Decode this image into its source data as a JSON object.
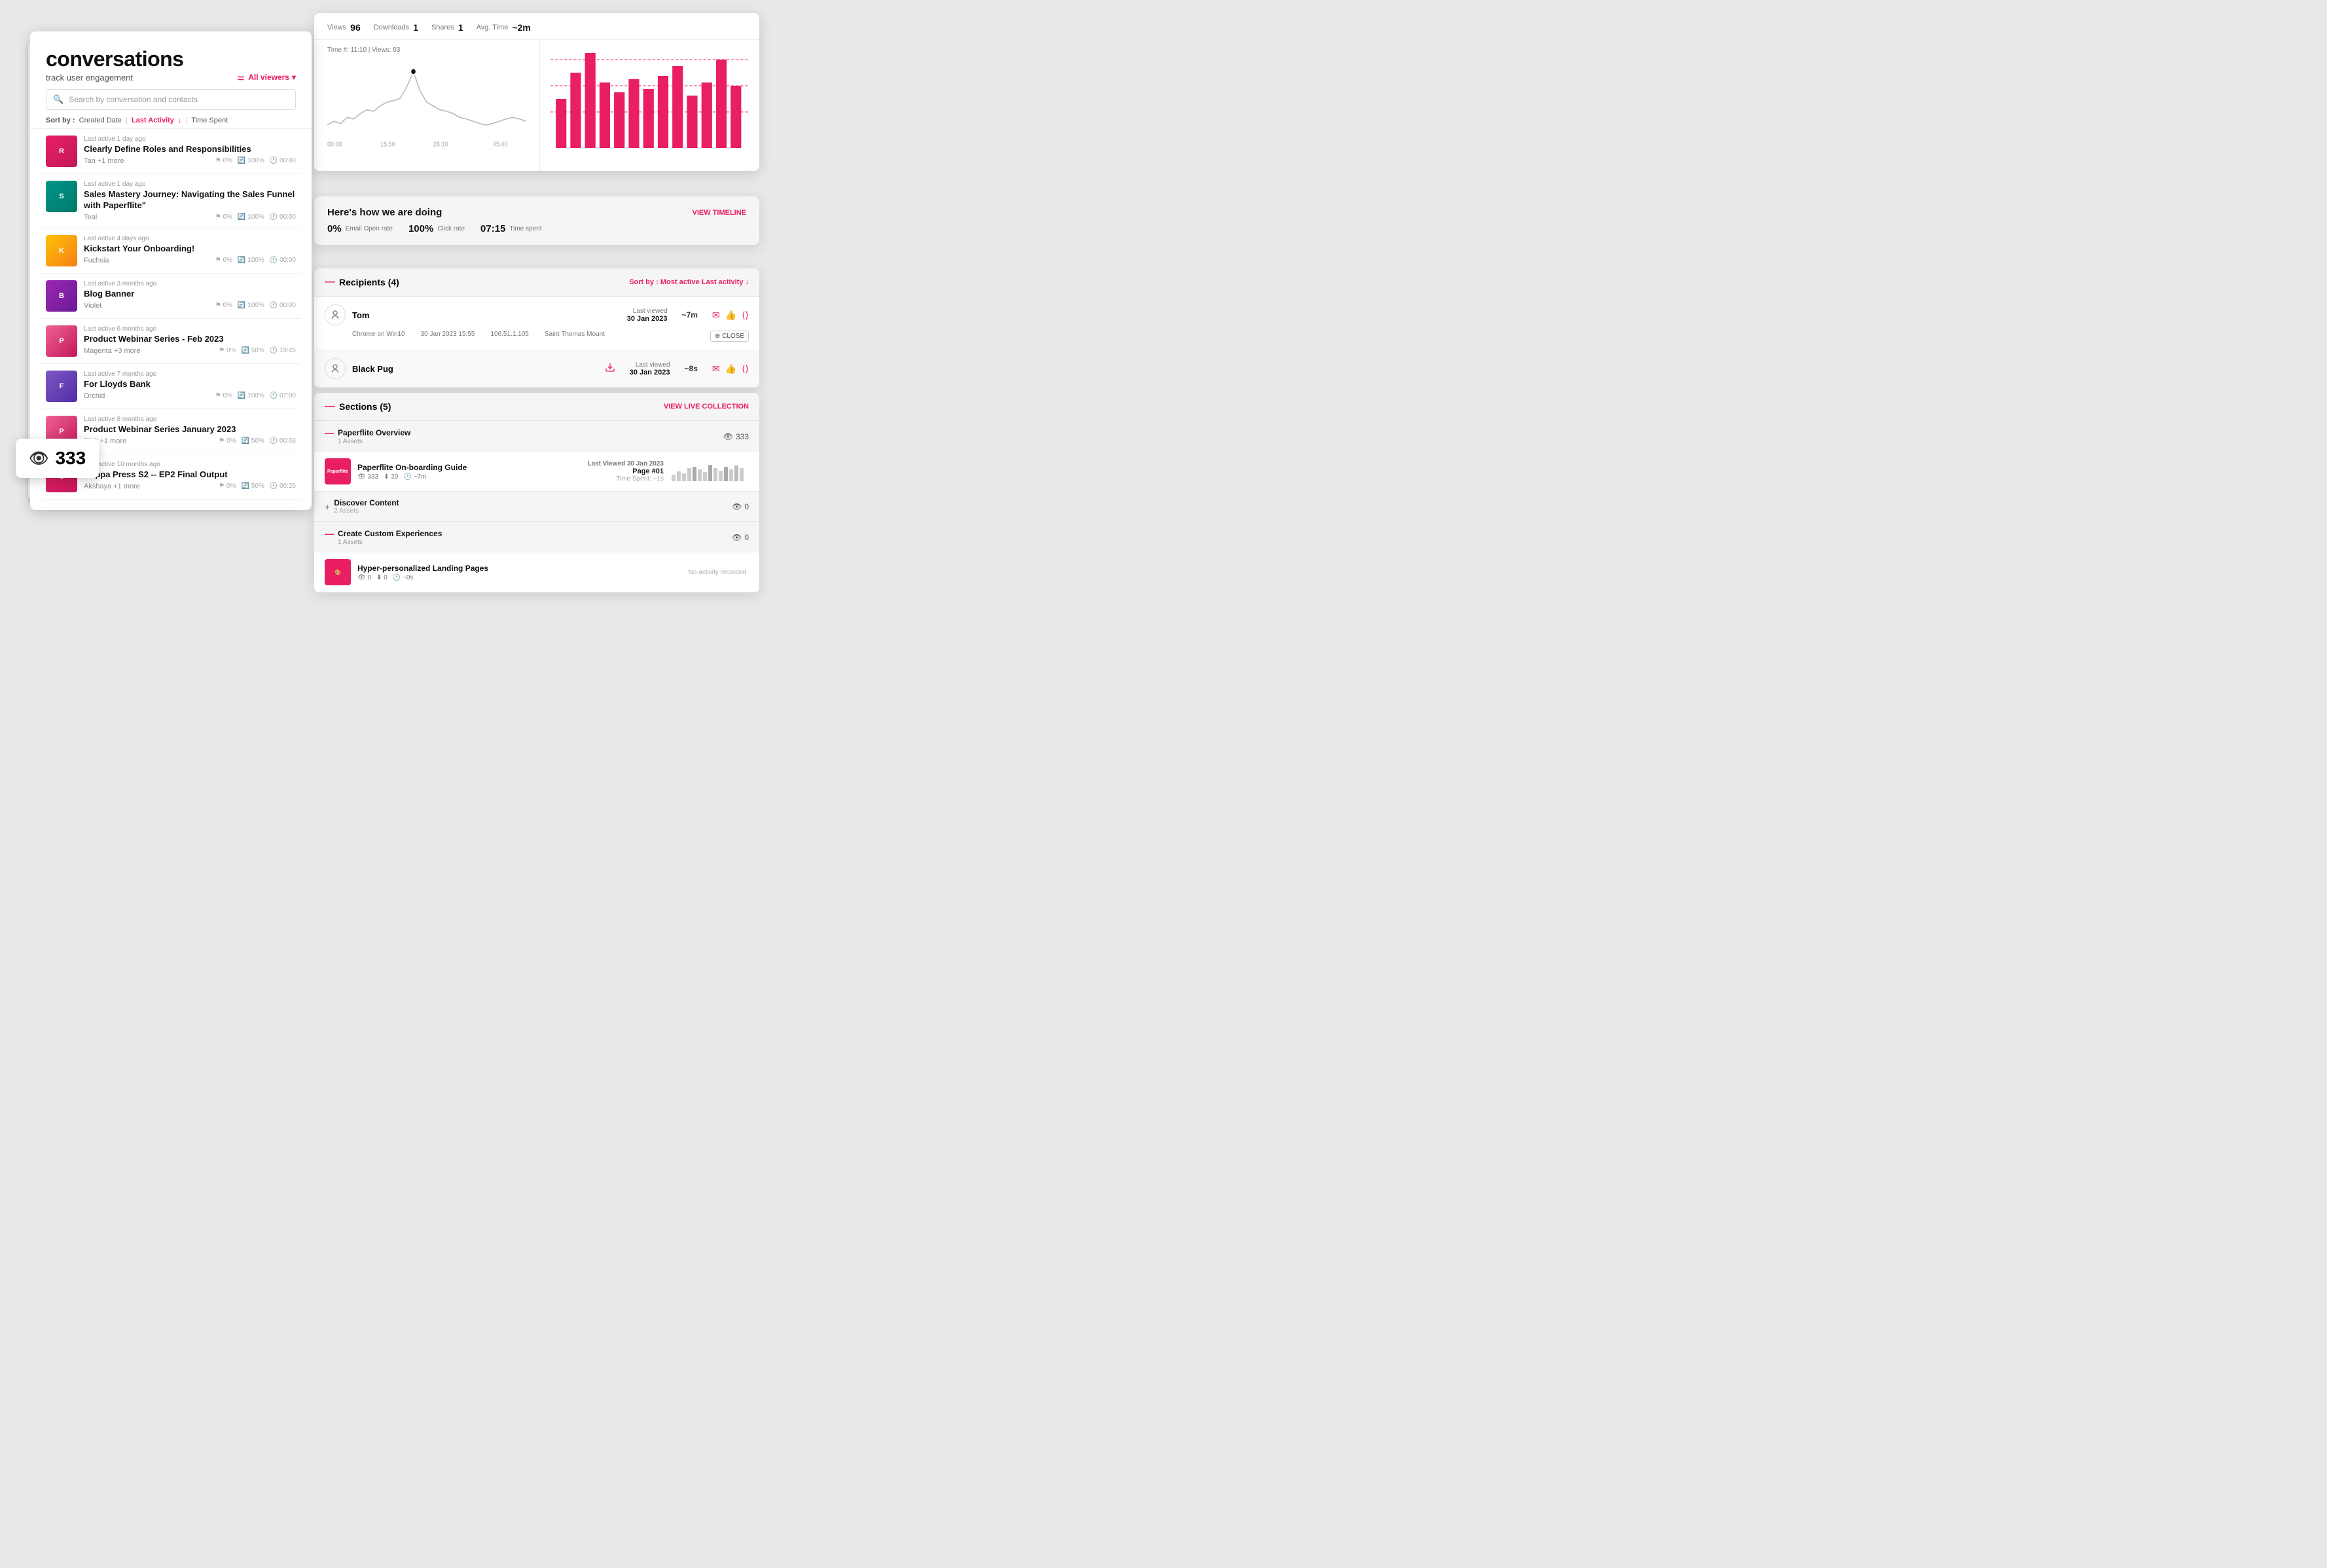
{
  "app": {
    "title": "conversations",
    "subtitle": "track user engagement",
    "filter_label": "All viewers",
    "search_placeholder": "Search by conversation and contacts"
  },
  "sort": {
    "label": "Sort by :",
    "options": [
      "Created Date",
      "Last Activity",
      "Time Spent"
    ],
    "active": "Last Activity"
  },
  "conversations": [
    {
      "id": 1,
      "time": "Last active 1 day ago",
      "title": "Clearly Define Roles and Responsibilities",
      "tag": "Tan +1 more",
      "open_rate": "0%",
      "click_rate": "100%",
      "time_spent": "00:00",
      "thumb_class": "thumb-red",
      "thumb_letter": "R"
    },
    {
      "id": 2,
      "time": "Last active 1 day ago",
      "title": "Sales Mastery Journey: Navigating the Sales Funnel with Paperflite\"",
      "tag": "Teal",
      "open_rate": "0%",
      "click_rate": "100%",
      "time_spent": "00:00",
      "thumb_class": "thumb-teal",
      "thumb_letter": "S"
    },
    {
      "id": 3,
      "time": "Last active 4 days ago",
      "title": "Kickstart Your Onboarding!",
      "tag": "Fuchsia",
      "open_rate": "0%",
      "click_rate": "100%",
      "time_spent": "00:00",
      "thumb_class": "thumb-yellow",
      "thumb_letter": "K"
    },
    {
      "id": 4,
      "time": "Last active 3 months ago",
      "title": "Blog Banner",
      "tag": "Violet",
      "open_rate": "0%",
      "click_rate": "100%",
      "time_spent": "00:00",
      "thumb_class": "thumb-violet",
      "thumb_letter": "B"
    },
    {
      "id": 5,
      "time": "Last active 6 months ago",
      "title": "Product Webinar Series - Feb 2023",
      "tag": "Magenta +3 more",
      "open_rate": "0%",
      "click_rate": "50%",
      "time_spent": "19:45",
      "thumb_class": "thumb-pink",
      "thumb_letter": "P"
    },
    {
      "id": 6,
      "time": "Last active 7 months ago",
      "title": "For Lloyds Bank",
      "tag": "Orchid",
      "open_rate": "0%",
      "click_rate": "100%",
      "time_spent": "07:00",
      "thumb_class": "thumb-orchid",
      "thumb_letter": "F"
    },
    {
      "id": 7,
      "time": "Last active 8 months ago",
      "title": "Product Webinar Series January 2023",
      "tag": "Pink +1 more",
      "open_rate": "0%",
      "click_rate": "50%",
      "time_spent": "00:03",
      "thumb_class": "thumb-pink",
      "thumb_letter": "P"
    },
    {
      "id": 8,
      "time": "Last active 10 months ago",
      "title": "Cuppa Press S2 -- EP2 Final Output",
      "tag": "Akshaya +1 more",
      "open_rate": "0%",
      "click_rate": "50%",
      "time_spent": "00:26",
      "thumb_class": "thumb-red",
      "thumb_letter": "C"
    }
  ],
  "views_badge": {
    "count": "333",
    "label": "views"
  },
  "analytics": {
    "stats": [
      {
        "label": "Views",
        "value": "96"
      },
      {
        "label": "Downloads",
        "value": "1"
      },
      {
        "label": "Shares",
        "value": "1"
      },
      {
        "label": "Avg. Time",
        "value": "~2m"
      }
    ],
    "timeline_label": "Time #: 11:10  |  Views: 03"
  },
  "engagement": {
    "title": "Here's how we are doing",
    "view_timeline": "VIEW TIMELINE",
    "stats": [
      {
        "value": "0%",
        "label": "Email Open rate"
      },
      {
        "value": "100%",
        "label": "Click rate"
      },
      {
        "value": "07:15",
        "label": "Time spent"
      }
    ]
  },
  "recipients": {
    "title": "Recipients (4)",
    "sort_label": "Sort by : Most active",
    "sort_active": "Last activity ↓",
    "list": [
      {
        "name": "Tom",
        "last_viewed_label": "Last viewed",
        "last_viewed_date": "30 Jan 2023",
        "time_ago": "~7m",
        "device": "Chrome on Win10",
        "datetime": "30 Jan 2023 15:55",
        "ip": "106.51.1.105",
        "location": "Saint Thomas Mount",
        "expanded": true
      },
      {
        "name": "Black Pug",
        "last_viewed_label": "Last viewed",
        "last_viewed_date": "30 Jan 2023",
        "time_ago": "~8s",
        "expanded": false
      }
    ]
  },
  "sections": {
    "title": "Sections (5)",
    "view_collection": "VIEW LIVE COLLECTION",
    "items": [
      {
        "name": "Paperflite Overview",
        "assets_count": "1 Assets",
        "views": "333",
        "expanded": true,
        "assets": [
          {
            "title": "Paperflite On-boarding Guide",
            "views": "333",
            "downloads": "20",
            "time": "~7m",
            "last_viewed": "Last Viewed 30 Jan 2023",
            "page": "Page #01",
            "time_spent": "Time Spent: ~1s",
            "has_chart": true
          }
        ]
      },
      {
        "name": "Discover Content",
        "assets_count": "2 Assets",
        "views": "0",
        "expanded": false,
        "assets": []
      },
      {
        "name": "Create Custom Experiences",
        "assets_count": "1 Assets",
        "views": "0",
        "expanded": true,
        "assets": [
          {
            "title": "Hyper-personalized Landing Pages",
            "views": "0",
            "downloads": "0",
            "time": "~0s",
            "no_activity": true
          }
        ]
      }
    ]
  }
}
